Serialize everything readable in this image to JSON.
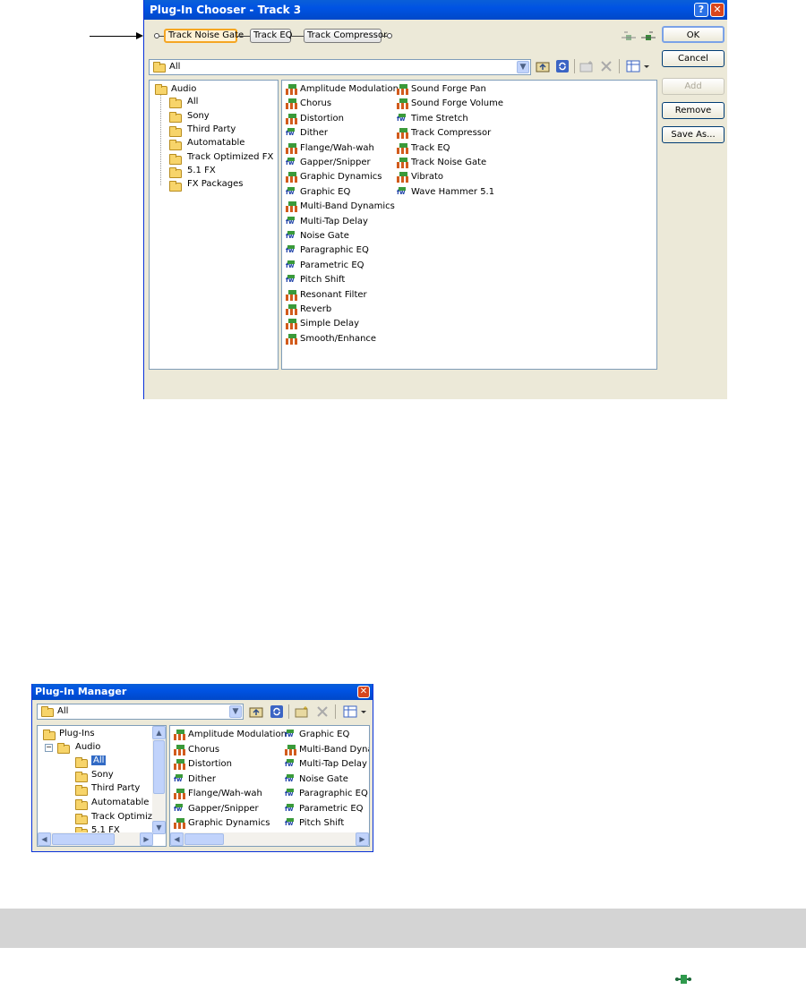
{
  "chooser": {
    "title": "Plug-In Chooser - Track 3",
    "help_glyph": "?",
    "close_glyph": "✕",
    "chain": [
      "Track Noise Gate",
      "Track EQ",
      "Track Compressor"
    ],
    "folder_select": "All",
    "buttons": {
      "ok": "OK",
      "cancel": "Cancel",
      "add": "Add",
      "remove": "Remove",
      "save_as": "Save As..."
    },
    "tree": {
      "root": "Audio",
      "children": [
        "All",
        "Sony",
        "Third Party",
        "Automatable",
        "Track Optimized FX",
        "5.1 FX",
        "FX Packages"
      ]
    },
    "plugins_col1": [
      {
        "name": "Amplitude Modulation",
        "icon": "dx-plugin-icon"
      },
      {
        "name": "Chorus",
        "icon": "dx-plugin-icon"
      },
      {
        "name": "Distortion",
        "icon": "dx-plugin-icon"
      },
      {
        "name": "Dither",
        "icon": "vst-plugin-icon"
      },
      {
        "name": "Flange/Wah-wah",
        "icon": "dx-plugin-icon"
      },
      {
        "name": "Gapper/Snipper",
        "icon": "vst-plugin-icon"
      },
      {
        "name": "Graphic Dynamics",
        "icon": "dx-plugin-icon"
      },
      {
        "name": "Graphic EQ",
        "icon": "vst-plugin-icon"
      },
      {
        "name": "Multi-Band Dynamics",
        "icon": "dx-plugin-icon"
      },
      {
        "name": "Multi-Tap Delay",
        "icon": "vst-plugin-icon"
      },
      {
        "name": "Noise Gate",
        "icon": "vst-plugin-icon"
      },
      {
        "name": "Paragraphic EQ",
        "icon": "vst-plugin-icon"
      },
      {
        "name": "Parametric EQ",
        "icon": "vst-plugin-icon"
      },
      {
        "name": "Pitch Shift",
        "icon": "vst-plugin-icon"
      },
      {
        "name": "Resonant Filter",
        "icon": "dx-plugin-icon"
      },
      {
        "name": "Reverb",
        "icon": "dx-plugin-icon"
      },
      {
        "name": "Simple Delay",
        "icon": "dx-plugin-icon"
      },
      {
        "name": "Smooth/Enhance",
        "icon": "dx-plugin-icon"
      }
    ],
    "plugins_col2": [
      {
        "name": "Sound Forge Pan",
        "icon": "dx-plugin-icon"
      },
      {
        "name": "Sound Forge Volume",
        "icon": "dx-plugin-icon"
      },
      {
        "name": "Time Stretch",
        "icon": "vst-plugin-icon"
      },
      {
        "name": "Track Compressor",
        "icon": "dx-plugin-icon"
      },
      {
        "name": "Track EQ",
        "icon": "dx-plugin-icon"
      },
      {
        "name": "Track Noise Gate",
        "icon": "dx-plugin-icon"
      },
      {
        "name": "Vibrato",
        "icon": "dx-plugin-icon"
      },
      {
        "name": "Wave Hammer 5.1",
        "icon": "vst-plugin-icon"
      }
    ]
  },
  "manager": {
    "title": "Plug-In Manager",
    "close_glyph": "✕",
    "folder_select": "All",
    "tree": {
      "root": "Plug-Ins",
      "sub": "Audio",
      "children": [
        "All",
        "Sony",
        "Third Party",
        "Automatable",
        "Track Optimize",
        "5.1 FX"
      ],
      "selected": "All"
    },
    "plugins_col1": [
      {
        "name": "Amplitude Modulation",
        "icon": "dx-plugin-icon"
      },
      {
        "name": "Chorus",
        "icon": "dx-plugin-icon"
      },
      {
        "name": "Distortion",
        "icon": "dx-plugin-icon"
      },
      {
        "name": "Dither",
        "icon": "vst-plugin-icon"
      },
      {
        "name": "Flange/Wah-wah",
        "icon": "dx-plugin-icon"
      },
      {
        "name": "Gapper/Snipper",
        "icon": "vst-plugin-icon"
      },
      {
        "name": "Graphic Dynamics",
        "icon": "dx-plugin-icon"
      }
    ],
    "plugins_col2": [
      {
        "name": "Graphic EQ",
        "icon": "vst-plugin-icon"
      },
      {
        "name": "Multi-Band Dynan",
        "icon": "dx-plugin-icon"
      },
      {
        "name": "Multi-Tap Delay",
        "icon": "vst-plugin-icon"
      },
      {
        "name": "Noise Gate",
        "icon": "vst-plugin-icon"
      },
      {
        "name": "Paragraphic EQ",
        "icon": "vst-plugin-icon"
      },
      {
        "name": "Parametric EQ",
        "icon": "vst-plugin-icon"
      },
      {
        "name": "Pitch Shift",
        "icon": "vst-plugin-icon"
      }
    ]
  },
  "colors": {
    "accent": "#0053e3",
    "banner": "#d4d4d4",
    "chain_highlight": "#f5a623"
  }
}
